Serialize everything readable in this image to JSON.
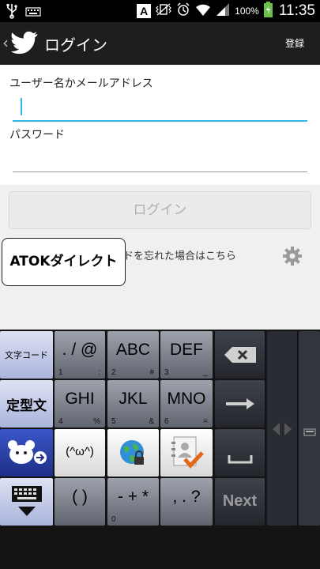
{
  "status_bar": {
    "left_icons": [
      "usb-icon",
      "keyboard-icon"
    ],
    "input_mode_indicator": "A",
    "battery_percent": "100%",
    "time": "11:35"
  },
  "action_bar": {
    "title": "ログイン",
    "register_label": "登録",
    "logo_icon": "twitter-bird-icon",
    "colors": {
      "background": "#1e1e1e"
    }
  },
  "login_form": {
    "username_label": "ユーザー名かメールアドレス",
    "username_value": "",
    "password_label": "パスワード",
    "password_value": "",
    "login_button_label": "ログイン",
    "forgot_text": "ドを忘れた場合はこちら",
    "accent_color": "#33b5e5"
  },
  "ime_popup": {
    "label": "ATOKダイレクト"
  },
  "keyboard": {
    "side_keys": {
      "char_code": "文字コード",
      "template": "定型文"
    },
    "keys": [
      {
        "name": "key-punct",
        "label": ". / @",
        "sub_left": "1",
        "sub_right": ":"
      },
      {
        "name": "key-abc",
        "label": "ABC",
        "sub_left": "2",
        "sub_right": "#"
      },
      {
        "name": "key-def",
        "label": "DEF",
        "sub_left": "3",
        "sub_right": "_"
      },
      {
        "name": "key-ghi",
        "label": "GHI",
        "sub_left": "4",
        "sub_right": "%"
      },
      {
        "name": "key-jkl",
        "label": "JKL",
        "sub_left": "5",
        "sub_right": "&"
      },
      {
        "name": "key-mno",
        "label": "MNO",
        "sub_left": "6",
        "sub_right": "="
      },
      {
        "name": "key-paren",
        "label": "( )",
        "sub_left": "",
        "sub_right": ""
      },
      {
        "name": "key-math",
        "label": "- + *",
        "sub_left": "0",
        "sub_right": ""
      },
      {
        "name": "key-comma",
        "label": ", . ?",
        "sub_left": "",
        "sub_right": ""
      }
    ],
    "emoticon_label": "(^ω^)",
    "next_label": "Next"
  }
}
